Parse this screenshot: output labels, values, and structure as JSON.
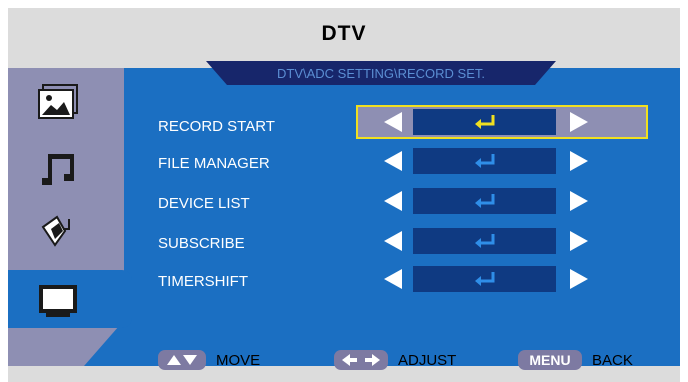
{
  "header": {
    "title": "DTV"
  },
  "breadcrumb": "DTV\\ADC SETTING\\RECORD SET.",
  "sidebar": {
    "items": [
      {
        "icon": "picture-icon"
      },
      {
        "icon": "music-icon"
      },
      {
        "icon": "pen-tool-icon"
      },
      {
        "icon": "monitor-icon",
        "active": true
      }
    ]
  },
  "menu": {
    "items": [
      {
        "label": "RECORD START",
        "selected": true
      },
      {
        "label": "FILE MANAGER"
      },
      {
        "label": "DEVICE LIST"
      },
      {
        "label": "SUBSCRIBE"
      },
      {
        "label": "TIMERSHIFT"
      }
    ]
  },
  "footer": {
    "move": {
      "key": "",
      "label": "MOVE"
    },
    "adjust": {
      "key": "",
      "label": "ADJUST"
    },
    "back": {
      "key": "MENU",
      "label": "BACK"
    }
  },
  "colors": {
    "panel_blue": "#1b6fc2",
    "value_box": "#0f3a82",
    "selection_border": "#f0e020",
    "enter_selected": "#f0e020",
    "enter_normal": "#2f8ee8"
  }
}
